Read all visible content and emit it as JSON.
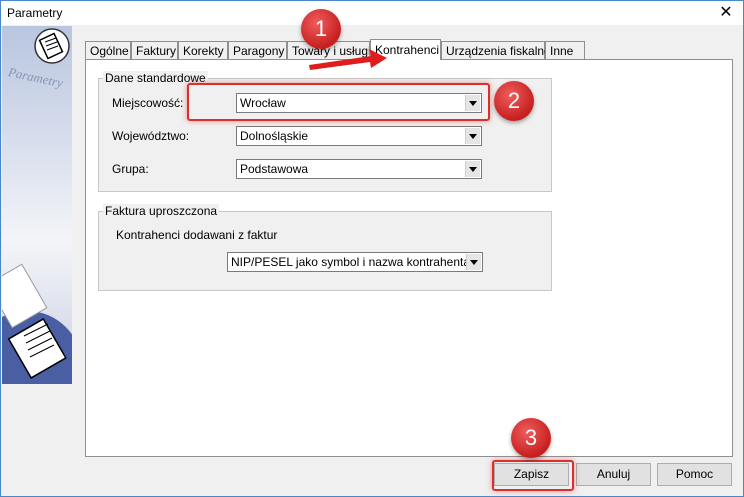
{
  "window": {
    "title": "Parametry"
  },
  "sidebar": {
    "logo_text": "Parametry"
  },
  "tabs": [
    {
      "label": "Ogólne"
    },
    {
      "label": "Faktury"
    },
    {
      "label": "Korekty"
    },
    {
      "label": "Paragony"
    },
    {
      "label": "Towary i usługi"
    },
    {
      "label": "Kontrahenci"
    },
    {
      "label": "Urządzenia fiskalne"
    },
    {
      "label": "Inne"
    }
  ],
  "active_tab": "Kontrahenci",
  "dane_standardowe": {
    "legend": "Dane standardowe",
    "miejscowosc": {
      "label": "Miejscowość:",
      "value": "Wrocław"
    },
    "wojewodztwo": {
      "label": "Województwo:",
      "value": "Dolnośląskie"
    },
    "grupa": {
      "label": "Grupa:",
      "value": "Podstawowa"
    }
  },
  "faktura_uproszczona": {
    "legend": "Faktura uproszczona",
    "description": "Kontrahenci dodawani z faktur",
    "select_value": "NIP/PESEL jako symbol i nazwa kontrahenta"
  },
  "buttons": {
    "save": "Zapisz",
    "cancel": "Anuluj",
    "help": "Pomoc"
  },
  "annotations": {
    "step1": "1",
    "step2": "2",
    "step3": "3"
  },
  "colors": {
    "badge": "#d9302e",
    "title_border": "#4a87c8"
  }
}
